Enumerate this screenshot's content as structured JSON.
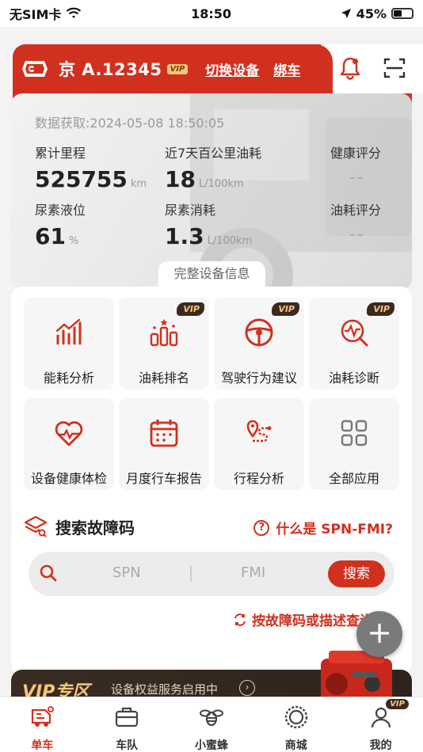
{
  "status_bar": {
    "carrier": "无SIM卡",
    "time": "18:50",
    "battery": "45%",
    "battery_level": 0.45
  },
  "header": {
    "plate": "京 A.12345",
    "vip": "VIP",
    "switch_device": "切换设备",
    "bind_car": "绑车"
  },
  "stats": {
    "data_time": "数据获取:2024-05-08 18:50:05",
    "mileage_label": "累计里程",
    "mileage_value": "525755",
    "mileage_unit": "km",
    "fuel7_label": "近7天百公里油耗",
    "fuel7_value": "18",
    "fuel7_unit": "L/100km",
    "health_label": "健康评分",
    "health_value": "--",
    "urea_label": "尿素液位",
    "urea_value": "61",
    "urea_unit": "%",
    "urea_use_label": "尿素消耗",
    "urea_use_value": "1.3",
    "urea_use_unit": "L/100km",
    "fuel_score_label": "油耗评分",
    "fuel_score_value": "--",
    "full_info": "完整设备信息"
  },
  "tiles": [
    {
      "label": "能耗分析",
      "icon": "energy-chart-icon"
    },
    {
      "label": "油耗排名",
      "icon": "ranking-icon",
      "vip": "VIP"
    },
    {
      "label": "驾驶行为建议",
      "icon": "steering-wheel-icon",
      "vip": "VIP"
    },
    {
      "label": "油耗诊断",
      "icon": "diagnosis-icon",
      "vip": "VIP"
    },
    {
      "label": "设备健康体检",
      "icon": "heart-pulse-icon"
    },
    {
      "label": "月度行车报告",
      "icon": "calendar-icon"
    },
    {
      "label": "行程分析",
      "icon": "route-icon"
    },
    {
      "label": "全部应用",
      "icon": "apps-grid-icon"
    }
  ],
  "fault_search": {
    "title": "搜索故障码",
    "what_link": "什么是 SPN-FMI?",
    "spn_placeholder": "SPN",
    "fmi_placeholder": "FMI",
    "search_button": "搜索",
    "by_desc_link": "按故障码或描述查询"
  },
  "vip_zone": {
    "title": "VIP专区",
    "subtitle": "设备权益服务启用中"
  },
  "nav": [
    {
      "label": "单车",
      "active": true
    },
    {
      "label": "车队"
    },
    {
      "label": "小蜜蜂"
    },
    {
      "label": "商城"
    },
    {
      "label": "我的",
      "vip": "VIP"
    }
  ],
  "colors": {
    "brand_red": "#d2301f",
    "vip_gold": "#f4c77a"
  }
}
